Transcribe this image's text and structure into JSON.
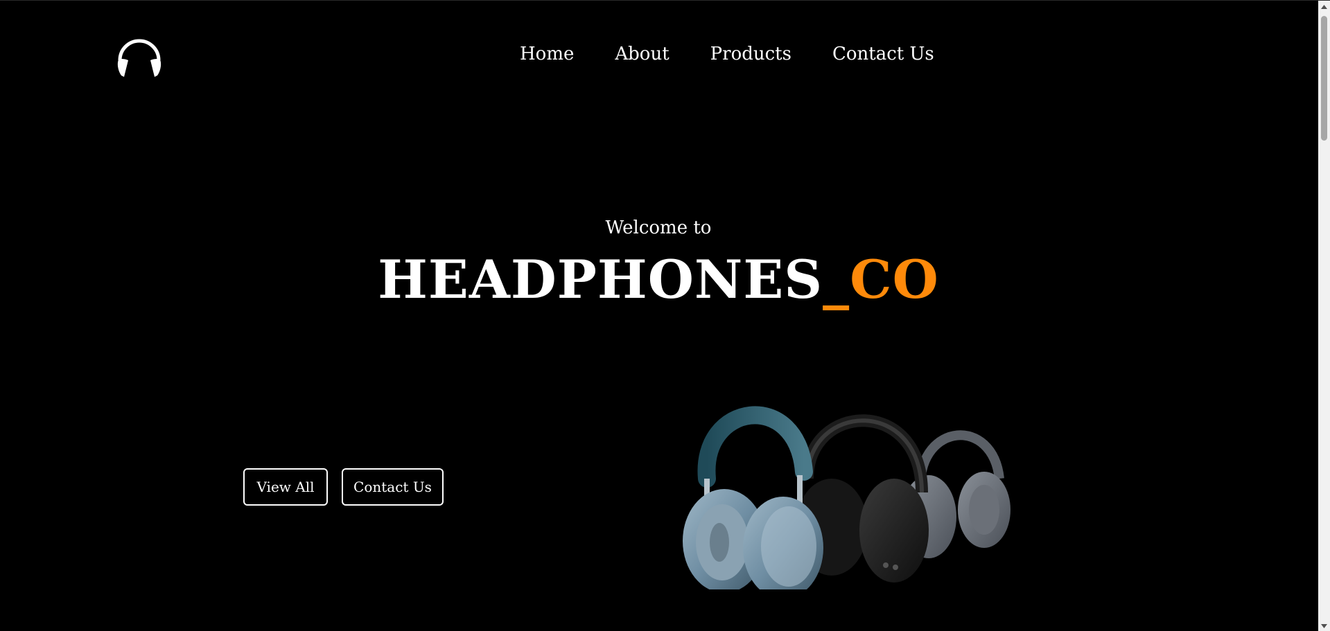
{
  "nav": {
    "items": [
      {
        "label": "Home"
      },
      {
        "label": "About"
      },
      {
        "label": "Products"
      },
      {
        "label": "Contact Us"
      }
    ]
  },
  "hero": {
    "welcome": "Welcome to",
    "brand_main": "HEADPHONES",
    "brand_accent": "_CO",
    "view_all_label": "View All",
    "contact_label": "Contact Us"
  },
  "colors": {
    "background": "#000000",
    "text": "#ffffff",
    "accent": "#ff8a0a"
  },
  "icons": {
    "logo": "headphones-icon",
    "product": "headphones-product-image"
  }
}
